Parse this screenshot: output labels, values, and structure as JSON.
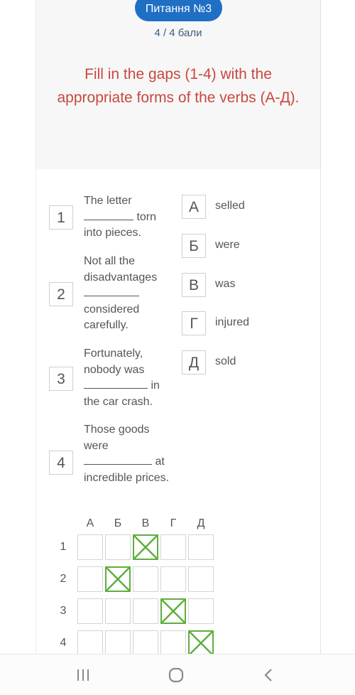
{
  "header": {
    "question_label": "Питання №3",
    "score": "4 / 4 бали",
    "task": "Fill in the gaps (1-4) with the appropriate forms of the verbs (А-Д)."
  },
  "sentences": [
    {
      "number": "1",
      "before": "The letter",
      "after": "torn into pieces."
    },
    {
      "number": "2",
      "before": "Not all the disadvantages",
      "after": "considered carefully."
    },
    {
      "number": "3",
      "before": "Fortunately, nobody was",
      "after": "in the car crash."
    },
    {
      "number": "4",
      "before": "Those goods were",
      "after": "at incredible prices."
    }
  ],
  "options": [
    {
      "letter": "А",
      "word": "selled"
    },
    {
      "letter": "Б",
      "word": "were"
    },
    {
      "letter": "В",
      "word": "was"
    },
    {
      "letter": "Г",
      "word": "injured"
    },
    {
      "letter": "Д",
      "word": "sold"
    }
  ],
  "answer_grid": {
    "columns": [
      "А",
      "Б",
      "В",
      "Г",
      "Д"
    ],
    "rows": [
      "1",
      "2",
      "3",
      "4"
    ],
    "selected": {
      "1": "В",
      "2": "Б",
      "3": "Г",
      "4": "Д"
    },
    "check_color": "#5fae3f"
  },
  "navbar": {
    "recent_apps": "recent-apps",
    "home": "home",
    "back": "back"
  },
  "colors": {
    "accent_blue": "#1f6fc5",
    "title_red": "#c8483e"
  }
}
